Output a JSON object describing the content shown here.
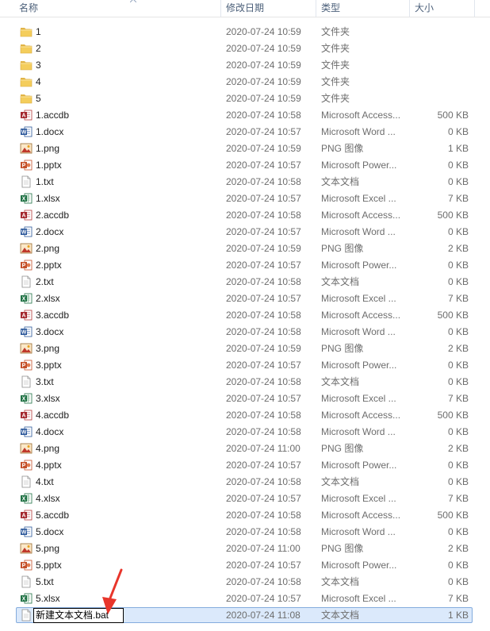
{
  "columns": {
    "name": "名称",
    "date": "修改日期",
    "type": "类型",
    "size": "大小"
  },
  "files": [
    {
      "name": "1",
      "date": "2020-07-24 10:59",
      "type": "文件夹",
      "size": "",
      "icon": "folder"
    },
    {
      "name": "2",
      "date": "2020-07-24 10:59",
      "type": "文件夹",
      "size": "",
      "icon": "folder"
    },
    {
      "name": "3",
      "date": "2020-07-24 10:59",
      "type": "文件夹",
      "size": "",
      "icon": "folder"
    },
    {
      "name": "4",
      "date": "2020-07-24 10:59",
      "type": "文件夹",
      "size": "",
      "icon": "folder"
    },
    {
      "name": "5",
      "date": "2020-07-24 10:59",
      "type": "文件夹",
      "size": "",
      "icon": "folder"
    },
    {
      "name": "1.accdb",
      "date": "2020-07-24 10:58",
      "type": "Microsoft Access...",
      "size": "500 KB",
      "icon": "access"
    },
    {
      "name": "1.docx",
      "date": "2020-07-24 10:57",
      "type": "Microsoft Word ...",
      "size": "0 KB",
      "icon": "word"
    },
    {
      "name": "1.png",
      "date": "2020-07-24 10:59",
      "type": "PNG 图像",
      "size": "1 KB",
      "icon": "image"
    },
    {
      "name": "1.pptx",
      "date": "2020-07-24 10:57",
      "type": "Microsoft Power...",
      "size": "0 KB",
      "icon": "powerpoint"
    },
    {
      "name": "1.txt",
      "date": "2020-07-24 10:58",
      "type": "文本文档",
      "size": "0 KB",
      "icon": "text"
    },
    {
      "name": "1.xlsx",
      "date": "2020-07-24 10:57",
      "type": "Microsoft Excel ...",
      "size": "7 KB",
      "icon": "excel"
    },
    {
      "name": "2.accdb",
      "date": "2020-07-24 10:58",
      "type": "Microsoft Access...",
      "size": "500 KB",
      "icon": "access"
    },
    {
      "name": "2.docx",
      "date": "2020-07-24 10:57",
      "type": "Microsoft Word ...",
      "size": "0 KB",
      "icon": "word"
    },
    {
      "name": "2.png",
      "date": "2020-07-24 10:59",
      "type": "PNG 图像",
      "size": "2 KB",
      "icon": "image"
    },
    {
      "name": "2.pptx",
      "date": "2020-07-24 10:57",
      "type": "Microsoft Power...",
      "size": "0 KB",
      "icon": "powerpoint"
    },
    {
      "name": "2.txt",
      "date": "2020-07-24 10:58",
      "type": "文本文档",
      "size": "0 KB",
      "icon": "text"
    },
    {
      "name": "2.xlsx",
      "date": "2020-07-24 10:57",
      "type": "Microsoft Excel ...",
      "size": "7 KB",
      "icon": "excel"
    },
    {
      "name": "3.accdb",
      "date": "2020-07-24 10:58",
      "type": "Microsoft Access...",
      "size": "500 KB",
      "icon": "access"
    },
    {
      "name": "3.docx",
      "date": "2020-07-24 10:58",
      "type": "Microsoft Word ...",
      "size": "0 KB",
      "icon": "word"
    },
    {
      "name": "3.png",
      "date": "2020-07-24 10:59",
      "type": "PNG 图像",
      "size": "2 KB",
      "icon": "image"
    },
    {
      "name": "3.pptx",
      "date": "2020-07-24 10:57",
      "type": "Microsoft Power...",
      "size": "0 KB",
      "icon": "powerpoint"
    },
    {
      "name": "3.txt",
      "date": "2020-07-24 10:58",
      "type": "文本文档",
      "size": "0 KB",
      "icon": "text"
    },
    {
      "name": "3.xlsx",
      "date": "2020-07-24 10:57",
      "type": "Microsoft Excel ...",
      "size": "7 KB",
      "icon": "excel"
    },
    {
      "name": "4.accdb",
      "date": "2020-07-24 10:58",
      "type": "Microsoft Access...",
      "size": "500 KB",
      "icon": "access"
    },
    {
      "name": "4.docx",
      "date": "2020-07-24 10:58",
      "type": "Microsoft Word ...",
      "size": "0 KB",
      "icon": "word"
    },
    {
      "name": "4.png",
      "date": "2020-07-24 11:00",
      "type": "PNG 图像",
      "size": "2 KB",
      "icon": "image"
    },
    {
      "name": "4.pptx",
      "date": "2020-07-24 10:57",
      "type": "Microsoft Power...",
      "size": "0 KB",
      "icon": "powerpoint"
    },
    {
      "name": "4.txt",
      "date": "2020-07-24 10:58",
      "type": "文本文档",
      "size": "0 KB",
      "icon": "text"
    },
    {
      "name": "4.xlsx",
      "date": "2020-07-24 10:57",
      "type": "Microsoft Excel ...",
      "size": "7 KB",
      "icon": "excel"
    },
    {
      "name": "5.accdb",
      "date": "2020-07-24 10:58",
      "type": "Microsoft Access...",
      "size": "500 KB",
      "icon": "access"
    },
    {
      "name": "5.docx",
      "date": "2020-07-24 10:58",
      "type": "Microsoft Word ...",
      "size": "0 KB",
      "icon": "word"
    },
    {
      "name": "5.png",
      "date": "2020-07-24 11:00",
      "type": "PNG 图像",
      "size": "2 KB",
      "icon": "image"
    },
    {
      "name": "5.pptx",
      "date": "2020-07-24 10:57",
      "type": "Microsoft Power...",
      "size": "0 KB",
      "icon": "powerpoint"
    },
    {
      "name": "5.txt",
      "date": "2020-07-24 10:58",
      "type": "文本文档",
      "size": "0 KB",
      "icon": "text"
    },
    {
      "name": "5.xlsx",
      "date": "2020-07-24 10:57",
      "type": "Microsoft Excel ...",
      "size": "7 KB",
      "icon": "excel"
    }
  ],
  "renaming": {
    "value": "新建文本文档.bat",
    "date": "2020-07-24 11:08",
    "type": "文本文档",
    "size": "1 KB",
    "icon": "text"
  },
  "colors": {
    "selection_bg": "#dbe9fb",
    "selection_border": "#84acdd",
    "annotation_arrow": "#e8352b"
  }
}
